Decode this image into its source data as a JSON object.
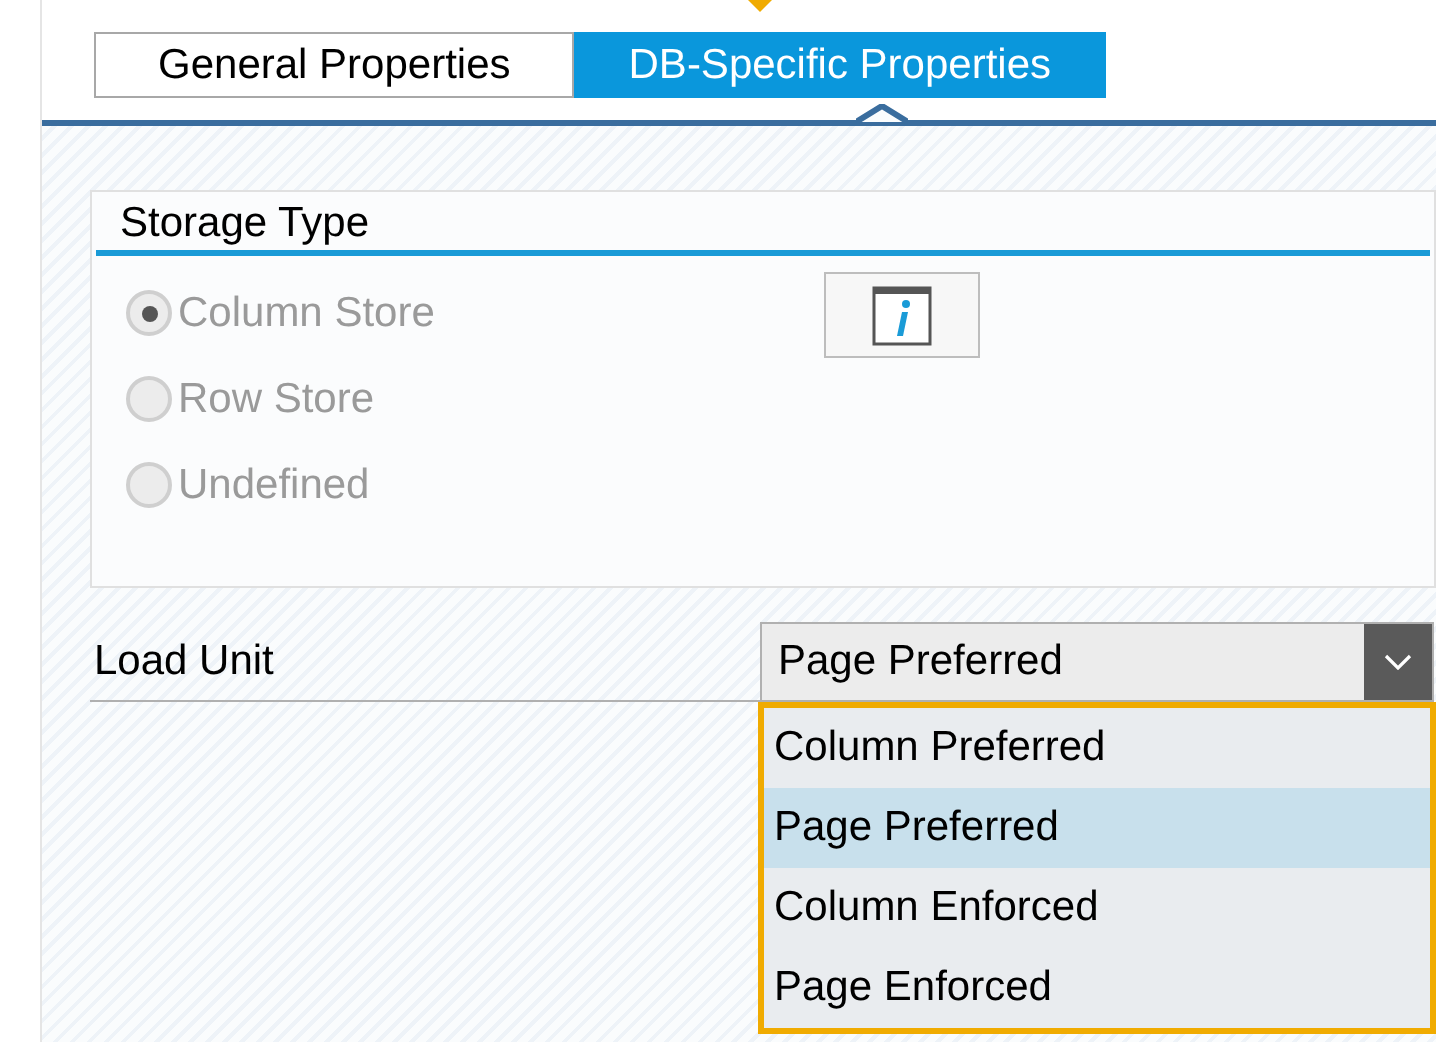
{
  "tabs": [
    {
      "label": "General Properties",
      "selected": false
    },
    {
      "label": "DB-Specific Properties",
      "selected": true
    }
  ],
  "storage_type": {
    "title": "Storage Type",
    "options": [
      {
        "label": "Column Store",
        "selected": true,
        "disabled": true
      },
      {
        "label": "Row Store",
        "selected": false,
        "disabled": true
      },
      {
        "label": "Undefined",
        "selected": false,
        "disabled": true
      }
    ]
  },
  "load_unit": {
    "label": "Load Unit",
    "value": "Page Preferred",
    "expanded": true,
    "options": [
      {
        "label": "Column Preferred",
        "selected": false
      },
      {
        "label": "Page Preferred",
        "selected": true
      },
      {
        "label": "Column Enforced",
        "selected": false
      },
      {
        "label": "Page Enforced",
        "selected": false
      }
    ]
  }
}
